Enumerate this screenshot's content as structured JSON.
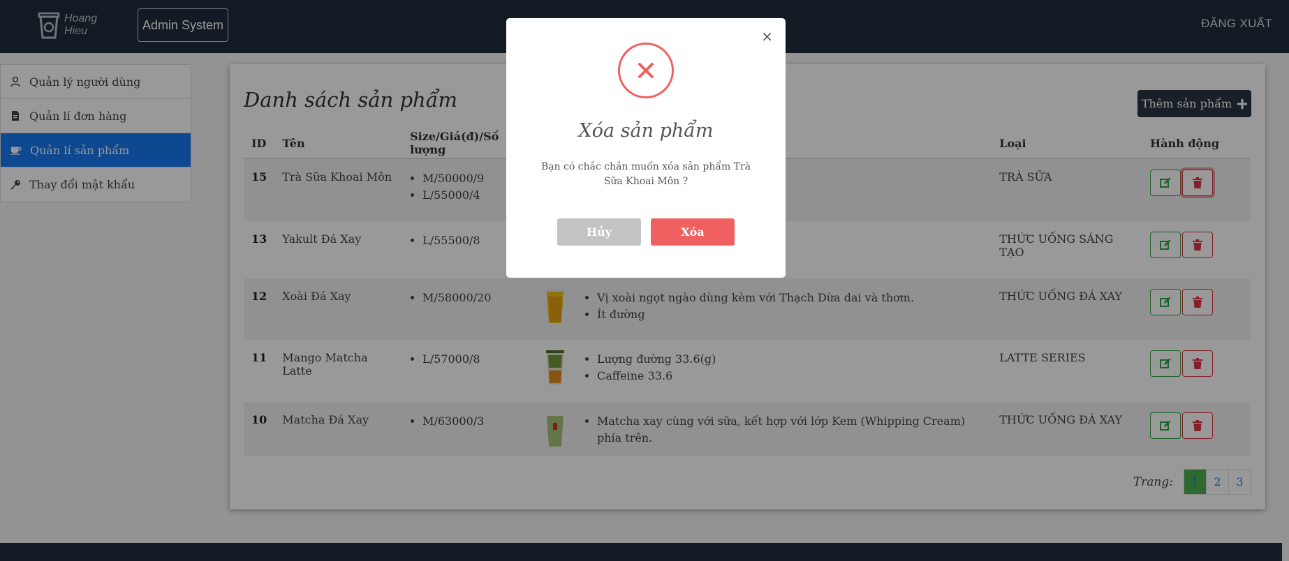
{
  "header": {
    "logo_line1": "Hoang",
    "logo_line2": "Hieu",
    "admin_label": "Admin System",
    "logout_label": "ĐĂNG XUẤT"
  },
  "sidebar": {
    "items": [
      {
        "label": "Quản lý người dùng",
        "icon": "user-icon"
      },
      {
        "label": "Quản lí đơn hàng",
        "icon": "document-icon"
      },
      {
        "label": "Quản lí sản phẩm",
        "icon": "coffee-cup-icon",
        "active": true
      },
      {
        "label": "Thay đổi mật khẩu",
        "icon": "key-icon"
      }
    ]
  },
  "main": {
    "title": "Danh sách sản phẩm",
    "add_label": "Thêm sản phẩm",
    "columns": {
      "id": "ID",
      "name": "Tên",
      "size": "Size/Giá(đ)/Số lượng",
      "kind": "Loại",
      "action": "Hành động"
    },
    "rows": [
      {
        "id": "15",
        "name": "Trà Sữa Khoai Môn",
        "sizes": [
          "M/50000/9",
          "L/55000/4"
        ],
        "desc": [],
        "kind": "TRÀ SỮA"
      },
      {
        "id": "13",
        "name": "Yakult Đá Xay",
        "sizes": [
          "L/55500/8"
        ],
        "desc": [],
        "kind": "THỨC UỐNG SÁNG TẠO"
      },
      {
        "id": "12",
        "name": "Xoài Đá Xay",
        "sizes": [
          "M/58000/20"
        ],
        "desc": [
          "Vị xoài ngọt ngào dùng kèm với Thạch Dừa dai và thơm.",
          "Ít đường"
        ],
        "kind": "THỨC UỐNG ĐÁ XAY"
      },
      {
        "id": "11",
        "name": "Mango Matcha Latte",
        "sizes": [
          "L/57000/8"
        ],
        "desc": [
          "Lượng đường 33.6(g)",
          "Caffeine 33.6"
        ],
        "kind": "LATTE SERIES"
      },
      {
        "id": "10",
        "name": "Matcha Đá Xay",
        "sizes": [
          "M/63000/3"
        ],
        "desc": [
          "Matcha xay cùng với sữa, kết hợp với lớp Kem (Whipping Cream) phía trên."
        ],
        "kind": "THỨC UỐNG ĐÁ XAY"
      }
    ],
    "pager_label": "Trang:",
    "pages": [
      "1",
      "2",
      "3"
    ]
  },
  "modal": {
    "close": "×",
    "title": "Xóa sản phẩm",
    "message": "Bạn có chắc chắn muốn xóa sản phẩm Trà Sữa Khoai Môn ?",
    "cancel_label": "Hủy",
    "confirm_label": "Xóa",
    "accent": "#f06060"
  }
}
